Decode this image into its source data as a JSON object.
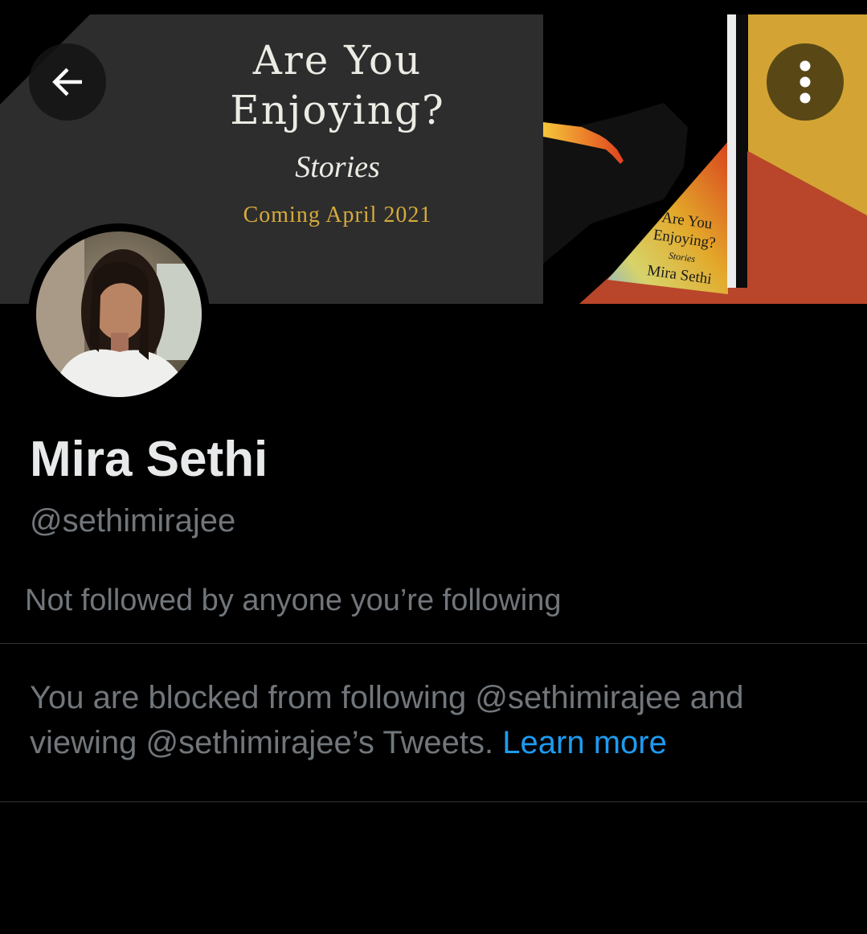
{
  "banner": {
    "title_line1": "Are You",
    "title_line2": "Enjoying?",
    "subtitle": "Stories",
    "coming": "Coming April 2021",
    "book_cover": {
      "title_line1": "Are You",
      "title_line2": "Enjoying?",
      "subtitle": "Stories",
      "author": "Mira Sethi"
    }
  },
  "nav": {
    "back_icon": "arrow-left-icon",
    "more_icon": "more-vertical-icon"
  },
  "profile": {
    "name": "Mira Sethi",
    "handle": "@sethimirajee",
    "followed_by": "Not followed by anyone you’re following",
    "blocked_message": "You are blocked from following @sethimirajee and viewing @sethimirajee’s Tweets.",
    "learn_more": "Learn more"
  },
  "colors": {
    "background": "#000000",
    "text_primary": "#e7e9ea",
    "text_secondary": "#71767b",
    "link": "#1d9bf0",
    "divider": "#2f3336"
  }
}
